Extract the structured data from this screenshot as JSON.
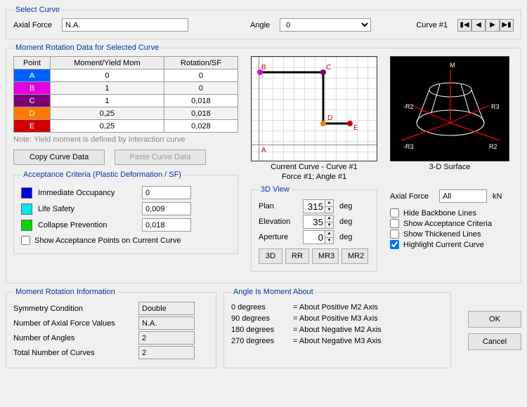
{
  "selectCurve": {
    "legend": "Select Curve",
    "axialLabel": "Axial Force",
    "axialValue": "N.A.",
    "angleLabel": "Angle",
    "angleValue": "0",
    "curveNum": "Curve #1"
  },
  "dataTable": {
    "legend": "Moment Rotation Data for Selected Curve",
    "headers": {
      "c1": "Point",
      "c2": "Moment/Yield Mom",
      "c3": "Rotation/SF"
    },
    "rows": [
      {
        "pt": "A",
        "m": "0",
        "r": "0",
        "bg": "#0060ff"
      },
      {
        "pt": "B",
        "m": "1",
        "r": "0",
        "bg": "#e000e0"
      },
      {
        "pt": "C",
        "m": "1",
        "r": "0,018",
        "bg": "#7a007a"
      },
      {
        "pt": "D",
        "m": "0,25",
        "r": "0,018",
        "bg": "#ff7a00"
      },
      {
        "pt": "E",
        "m": "0,25",
        "r": "0,028",
        "bg": "#d00000"
      }
    ],
    "note": "Note:  Yield moment is defined by interaction curve",
    "copyLabel": "Copy Curve Data",
    "pasteLabel": "Paste Curve Data",
    "plotCaptionA": "Current Curve - Curve #1",
    "plotCaptionB": "Force #1;  Angle #1",
    "surfCaption": "3-D Surface"
  },
  "acceptance": {
    "legend": "Acceptance Criteria (Plastic Deformation / SF)",
    "rows": [
      {
        "color": "#0000e0",
        "label": "Immediate Occupancy",
        "val": "0"
      },
      {
        "color": "#00eaea",
        "label": "Life Safety",
        "val": "0,009"
      },
      {
        "color": "#00d800",
        "label": "Collapse Prevention",
        "val": "0,018"
      }
    ],
    "showPtsLabel": "Show Acceptance Points on Current Curve"
  },
  "view3d": {
    "legend": "3D View",
    "planLabel": "Plan",
    "planVal": "315",
    "elevLabel": "Elevation",
    "elevVal": "35",
    "aperLabel": "Aperture",
    "aperVal": "0",
    "deg": "deg",
    "axialLabel": "Axial Force",
    "axialVal": "All",
    "kn": "kN",
    "btn3D": "3D",
    "btnRR": "RR",
    "btnMR3": "MR3",
    "btnMR2": "MR2",
    "cbHide": "Hide Backbone Lines",
    "cbAcc": "Show Acceptance Criteria",
    "cbThk": "Show Thickened Lines",
    "cbHi": "Highlight Current Curve"
  },
  "momentInfo": {
    "legend": "Moment Rotation Information",
    "sym": "Symmetry Condition",
    "symV": "Double",
    "naf": "Number of Axial Force Values",
    "nafV": "N.A.",
    "nang": "Number of Angles",
    "nangV": "2",
    "ncur": "Total Number of Curves",
    "ncurV": "2"
  },
  "angleLegend": {
    "legend": "Angle Is Moment About",
    "rows": [
      {
        "deg": "0 degrees",
        "txt": "= About Positive M2 Axis"
      },
      {
        "deg": "90 degrees",
        "txt": "= About Positive M3 Axis"
      },
      {
        "deg": "180 degrees",
        "txt": "= About Negative M2 Axis"
      },
      {
        "deg": "270 degrees",
        "txt": "= About Negative M3 Axis"
      }
    ]
  },
  "ok": "OK",
  "cancel": "Cancel"
}
